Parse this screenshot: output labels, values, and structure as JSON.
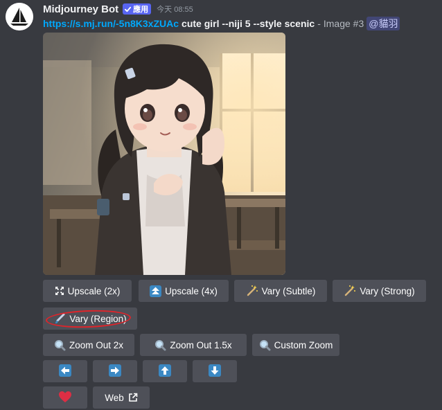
{
  "author": {
    "name": "Midjourney Bot",
    "badge": "應用",
    "timestamp": "今天 08:55",
    "avatar_icon": "sailboat-icon"
  },
  "message": {
    "link": "https://s.mj.run/-5n8K3xZUAc",
    "prompt": "cute girl --niji 5 --style scenic",
    "separator": "-",
    "image_label": "Image #3",
    "mention": "@貓羽"
  },
  "image": {
    "subject": "anime girl in classroom"
  },
  "buttons": {
    "upscale_2x": {
      "label": "Upscale (2x)",
      "icon": "expand-arrows-icon"
    },
    "upscale_4x": {
      "label": "Upscale (4x)",
      "icon": "double-up-arrow-icon"
    },
    "vary_subtle": {
      "label": "Vary (Subtle)",
      "icon": "magic-wand-icon"
    },
    "vary_strong": {
      "label": "Vary (Strong)",
      "icon": "magic-wand-icon"
    },
    "vary_region": {
      "label": "Vary (Region)",
      "icon": "paintbrush-icon",
      "highlight_color": "#e0242a"
    },
    "zoom_out_2x": {
      "label": "Zoom Out 2x",
      "icon": "magnifier-icon"
    },
    "zoom_out_1_5x": {
      "label": "Zoom Out 1.5x",
      "icon": "magnifier-icon"
    },
    "custom_zoom": {
      "label": "Custom Zoom",
      "icon": "magnifier-icon"
    },
    "pan_left": {
      "icon": "arrow-left-icon"
    },
    "pan_right": {
      "icon": "arrow-right-icon"
    },
    "pan_up": {
      "icon": "arrow-up-icon"
    },
    "pan_down": {
      "icon": "arrow-down-icon"
    },
    "favorite": {
      "icon": "red-heart-icon"
    },
    "web": {
      "label": "Web",
      "icon": "external-link-icon"
    }
  },
  "colors": {
    "background": "#383a40",
    "button": "#4e5058",
    "link": "#00a8fc",
    "badge": "#5865f2",
    "emoji_blue": "#3b88c3",
    "heart": "#dd2e44"
  }
}
